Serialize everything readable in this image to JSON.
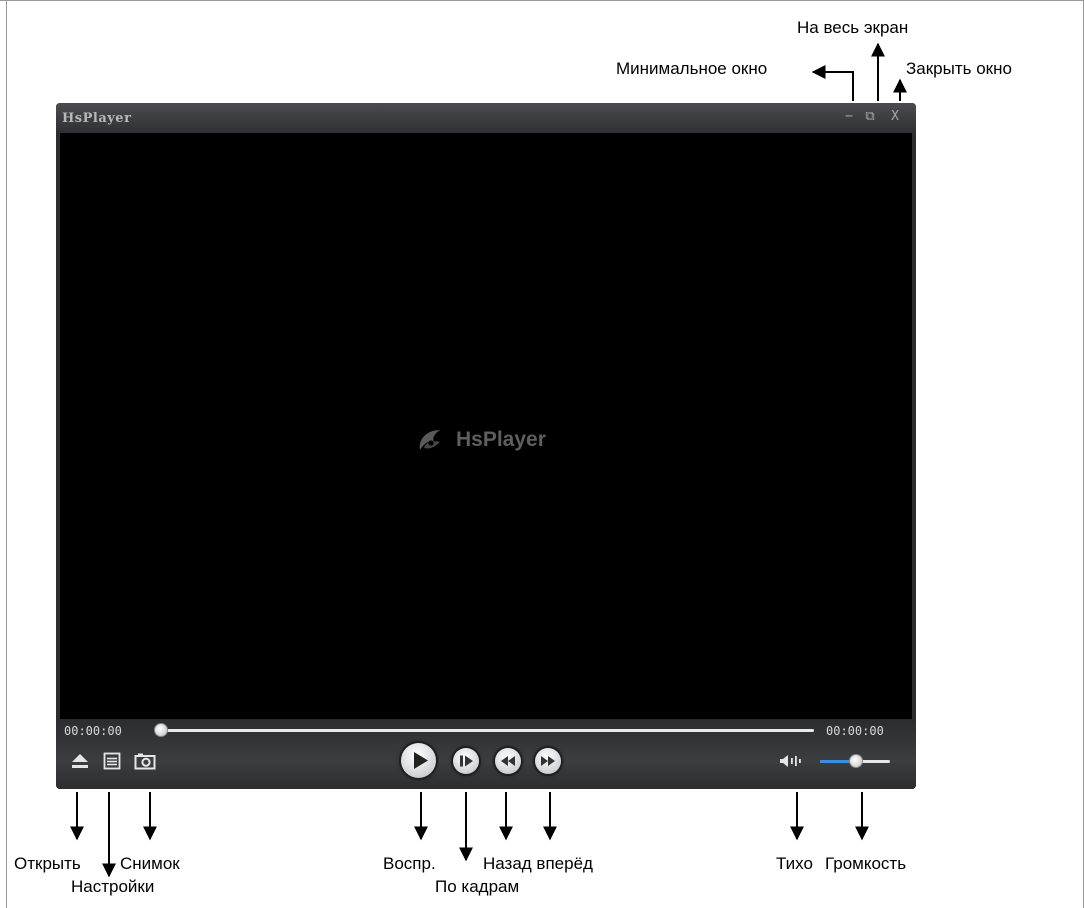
{
  "window": {
    "title": "HsPlayer",
    "minimize_glyph": "−",
    "maximize_glyph": "⧉",
    "close_glyph": "X"
  },
  "video": {
    "logo_text": "HsPlayer",
    "logo_icon": "hsplayer-logo-icon"
  },
  "playback": {
    "current_time": "00:00:00",
    "total_time": "00:00:00",
    "progress": 0
  },
  "volume": {
    "level": 0.5
  },
  "controls_icons": {
    "open": "eject-icon",
    "settings": "list-icon",
    "snapshot": "camera-icon",
    "play": "play-icon",
    "step": "step-frame-icon",
    "back": "rewind-icon",
    "forward": "fast-forward-icon",
    "mute": "speaker-icon"
  },
  "annotations": {
    "fullscreen": "На весь экран",
    "minimize": "Минимальное окно",
    "close": "Закрыть окно",
    "open": "Открыть",
    "settings": "Настройки",
    "snapshot": "Снимок",
    "play": "Воспр.",
    "step": "По кадрам",
    "back_forward": "Назад вперёд",
    "quiet": "Тихо",
    "volume": "Громкость"
  },
  "colors": {
    "accent": "#3a8ee0",
    "window_bg": "#2b2d2f",
    "video_bg": "#000000"
  }
}
